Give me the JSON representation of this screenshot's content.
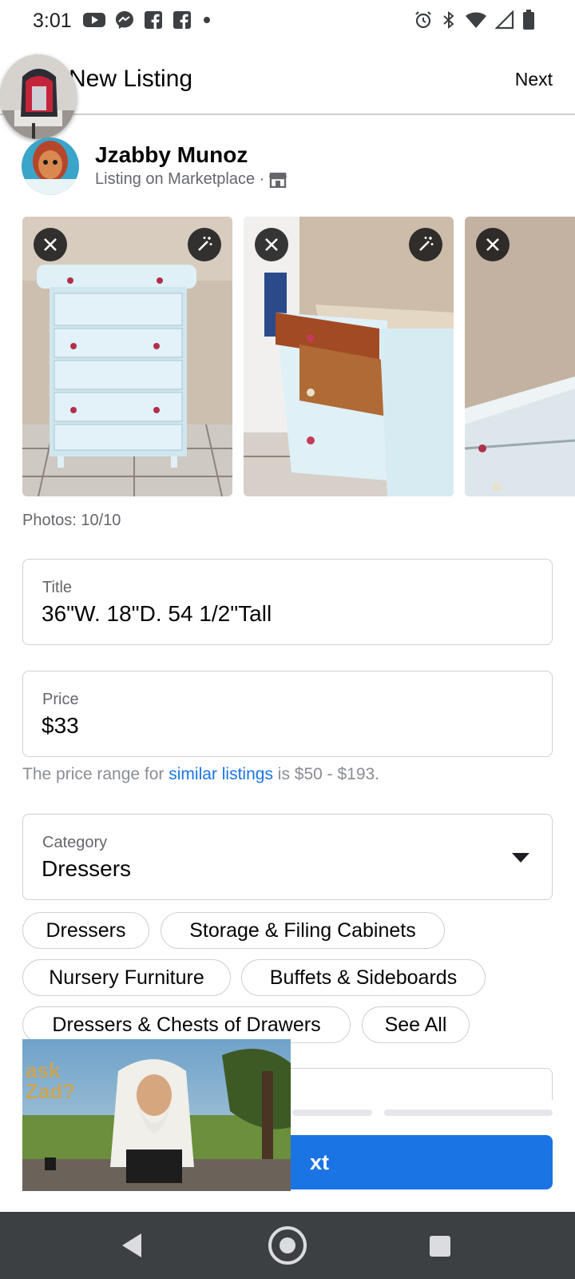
{
  "status_bar": {
    "time": "3:01",
    "left_icons": [
      "youtube-icon",
      "messenger-icon",
      "facebook-icon",
      "facebook-icon",
      "dot-icon"
    ],
    "right_icons": [
      "alarm-icon",
      "bluetooth-icon",
      "wifi-icon",
      "signal-icon",
      "battery-icon"
    ]
  },
  "header": {
    "title": "New Listing",
    "next_label": "Next"
  },
  "user": {
    "name": "Jzabby Munoz",
    "subtitle": "Listing on Marketplace ·"
  },
  "photos": {
    "count_label": "Photos: 10/10"
  },
  "form": {
    "title": {
      "label": "Title",
      "value": "36\"W. 18\"D. 54 1/2\"Tall"
    },
    "price": {
      "label": "Price",
      "value": "$33"
    },
    "price_hint": {
      "prefix": "The price range for ",
      "link": "similar listings",
      "suffix": " is $50 - $193."
    },
    "category": {
      "label": "Category",
      "value": "Dressers"
    }
  },
  "category_chips": [
    "Dressers",
    "Storage & Filing Cabinets",
    "Nursery Furniture",
    "Buffets & Sideboards",
    "Dressers & Chests of Drawers",
    "See All"
  ],
  "footer": {
    "next_button_visible_text": "xt"
  },
  "colors": {
    "accent": "#1b74e4",
    "navbar": "#3c4043",
    "secondary_text": "#65676b"
  }
}
